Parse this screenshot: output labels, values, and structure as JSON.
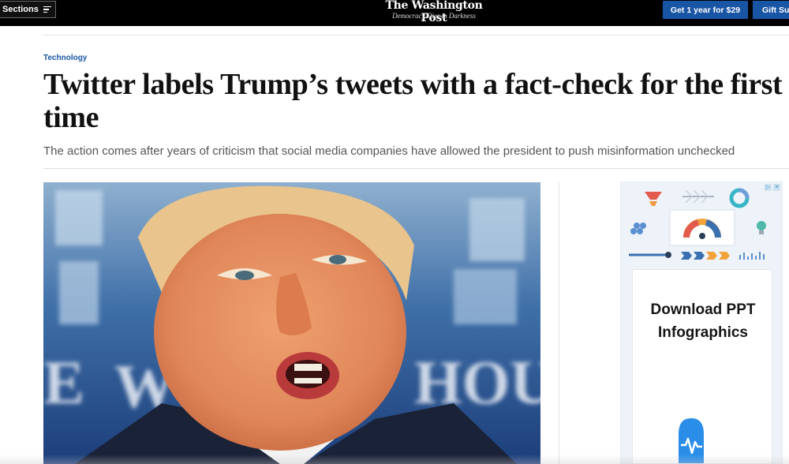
{
  "header": {
    "sections_label": "Sections",
    "logo": "The Washington Post",
    "tagline": "Democracy Dies in Darkness",
    "subscribe_label": "Get 1 year for $29",
    "gift_label": "Gift Sub"
  },
  "article": {
    "kicker": "Technology",
    "headline_line1": "Twitter labels Trump’s tweets with a fact-check for the first",
    "headline_line2": "time",
    "dek": "The action comes after years of criticism that social media companies have allowed the president to push misinformation unchecked"
  },
  "ad": {
    "headline_line1": "Download PPT",
    "headline_line2": "Infographics",
    "choices_icon": "ad-choices-icon",
    "close_icon": "close-icon"
  },
  "colors": {
    "topbar": "#000000",
    "brand_blue": "#1955a5",
    "kicker": "#1955a5",
    "headline": "#111111",
    "dek": "#555555"
  }
}
